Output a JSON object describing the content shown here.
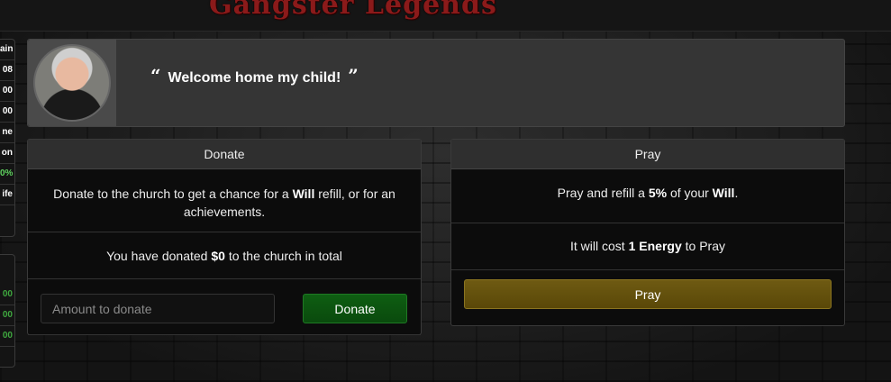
{
  "header": {
    "logo_text": "Gangster Legends"
  },
  "left_sidebar": {
    "stats_top": [
      "ain",
      "08",
      "00",
      "00",
      "ne",
      "on",
      "0%",
      "ife"
    ],
    "stats_bottom": [
      "00",
      "00",
      "00"
    ]
  },
  "welcome": {
    "open_quote": "“",
    "message": "Welcome home my child!",
    "close_quote": "”"
  },
  "donate_panel": {
    "title": "Donate",
    "description_pre": "Donate to the church to get a chance for a ",
    "description_bold": "Will",
    "description_post": " refill, or for an achievements.",
    "total_pre": "You have donated ",
    "total_amount": "$0",
    "total_post": " to the church in total",
    "amount_placeholder": "Amount to donate",
    "amount_value": "",
    "button_label": "Donate"
  },
  "pray_panel": {
    "title": "Pray",
    "refill_pre": "Pray and refill a ",
    "refill_percent": "5%",
    "refill_mid": " of your ",
    "refill_stat": "Will",
    "refill_post": ".",
    "cost_pre": "It will cost ",
    "cost_amount": "1 Energy",
    "cost_post": " to Pray",
    "button_label": "Pray"
  },
  "colors": {
    "donate_button": "#0b5310",
    "pray_button": "#65520f",
    "panel_header": "#2f2f2f",
    "welcome_bg": "#353535"
  }
}
